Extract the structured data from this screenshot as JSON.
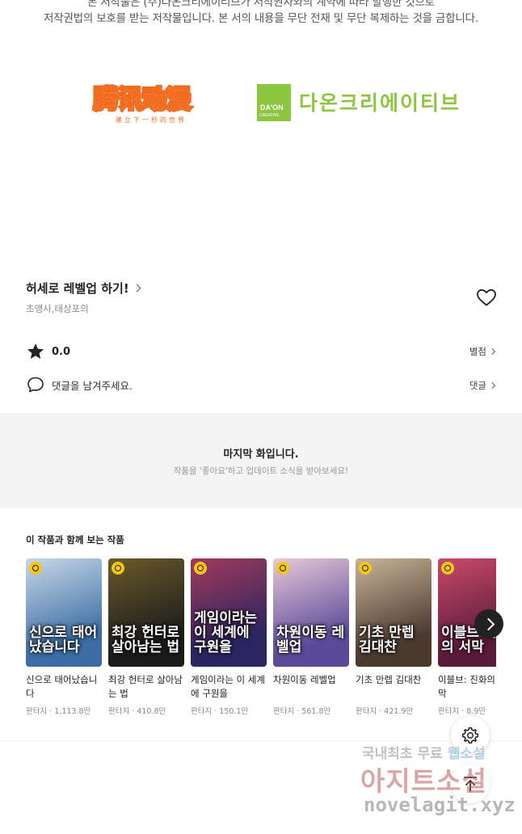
{
  "notice": {
    "line1": "본 저작물은 (주)다온크리에이티브가 저작권자와의 계약에 따라 발행한 것으로",
    "line2": "저작권법의 보호를 받는 저작물입니다. 본 서의 내용을 무단 전재 및 무단 복제하는 것을 금합니다."
  },
  "logos": {
    "tencent_main": "腾讯动漫",
    "tencent_sub": "建立下一秒的世界",
    "daon_box_top": "DA'ON",
    "daon_box_bottom": "CREATIVE",
    "daon_text": "다온크리에이티브",
    "tencent_color": "#f26b1d",
    "daon_color": "#8cc63e"
  },
  "work": {
    "title": "허세로 레벨업 하기!",
    "authors": "초앵사,태상포의",
    "rating": "0.0",
    "rating_link": "별점",
    "comment_prompt": "댓글을 남겨주세요.",
    "comment_link": "댓글"
  },
  "last_episode": {
    "title": "마지막 화입니다.",
    "subtitle": "작품을 '좋아요'하고 업데이트 소식을 받아보세요!"
  },
  "recommend": {
    "heading": "이 작품과 함께 보는 작품",
    "items": [
      {
        "name": "신으로 태어났습니다",
        "genre": "판타지",
        "views": "1,113.8만",
        "cover_text": "신으로 태어났습니다",
        "c1": "#3a6ea5",
        "c2": "#c9d7e6"
      },
      {
        "name": "최강 헌터로 살아남는 법",
        "genre": "판타지",
        "views": "410.8만",
        "cover_text": "최강 헌터로 살아남는 법",
        "c1": "#1b1b1b",
        "c2": "#6b5a2a"
      },
      {
        "name": "게임이라는 이 세계에 구원을",
        "genre": "판타지",
        "views": "150.1만",
        "cover_text": "게임이라는 이 세계에 구원을",
        "c1": "#2a2560",
        "c2": "#a23a5a"
      },
      {
        "name": "차원이동 레벨업",
        "genre": "판타지",
        "views": "561.8만",
        "cover_text": "차원이동 레벨업",
        "c1": "#5a4a9a",
        "c2": "#e8c9d8"
      },
      {
        "name": "기초 만렙 김대찬",
        "genre": "판타지",
        "views": "421.9만",
        "cover_text": "기초 만렙 김대찬",
        "c1": "#4a3a2e",
        "c2": "#c9b39a"
      },
      {
        "name": "이블브: 진화의 서막",
        "genre": "판타지",
        "views": "8.9만",
        "cover_text": "이블브 진화의 서막",
        "c1": "#5a1a3a",
        "c2": "#c94a6a"
      }
    ]
  },
  "watermark": {
    "line1": "국내최초 무료",
    "line1_hl": "웹소설",
    "line2": "아지트소설",
    "line3": "novelagit.xyz"
  }
}
